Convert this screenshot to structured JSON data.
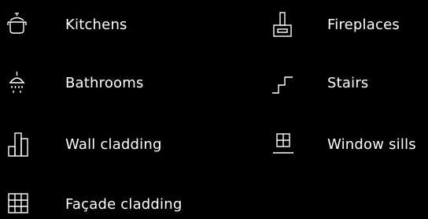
{
  "accent": "#ffffff",
  "background": "#000000",
  "items": [
    {
      "label": "Kitchens",
      "icon": "cooking-pot-icon"
    },
    {
      "label": "Bathrooms",
      "icon": "shower-icon"
    },
    {
      "label": "Wall cladding",
      "icon": "wall-cladding-icon"
    },
    {
      "label": "Façade cladding",
      "icon": "facade-grid-icon"
    },
    {
      "label": "Fireplaces",
      "icon": "fireplace-icon"
    },
    {
      "label": "Stairs",
      "icon": "stairs-icon"
    },
    {
      "label": "Window sills",
      "icon": "window-sill-icon"
    }
  ]
}
